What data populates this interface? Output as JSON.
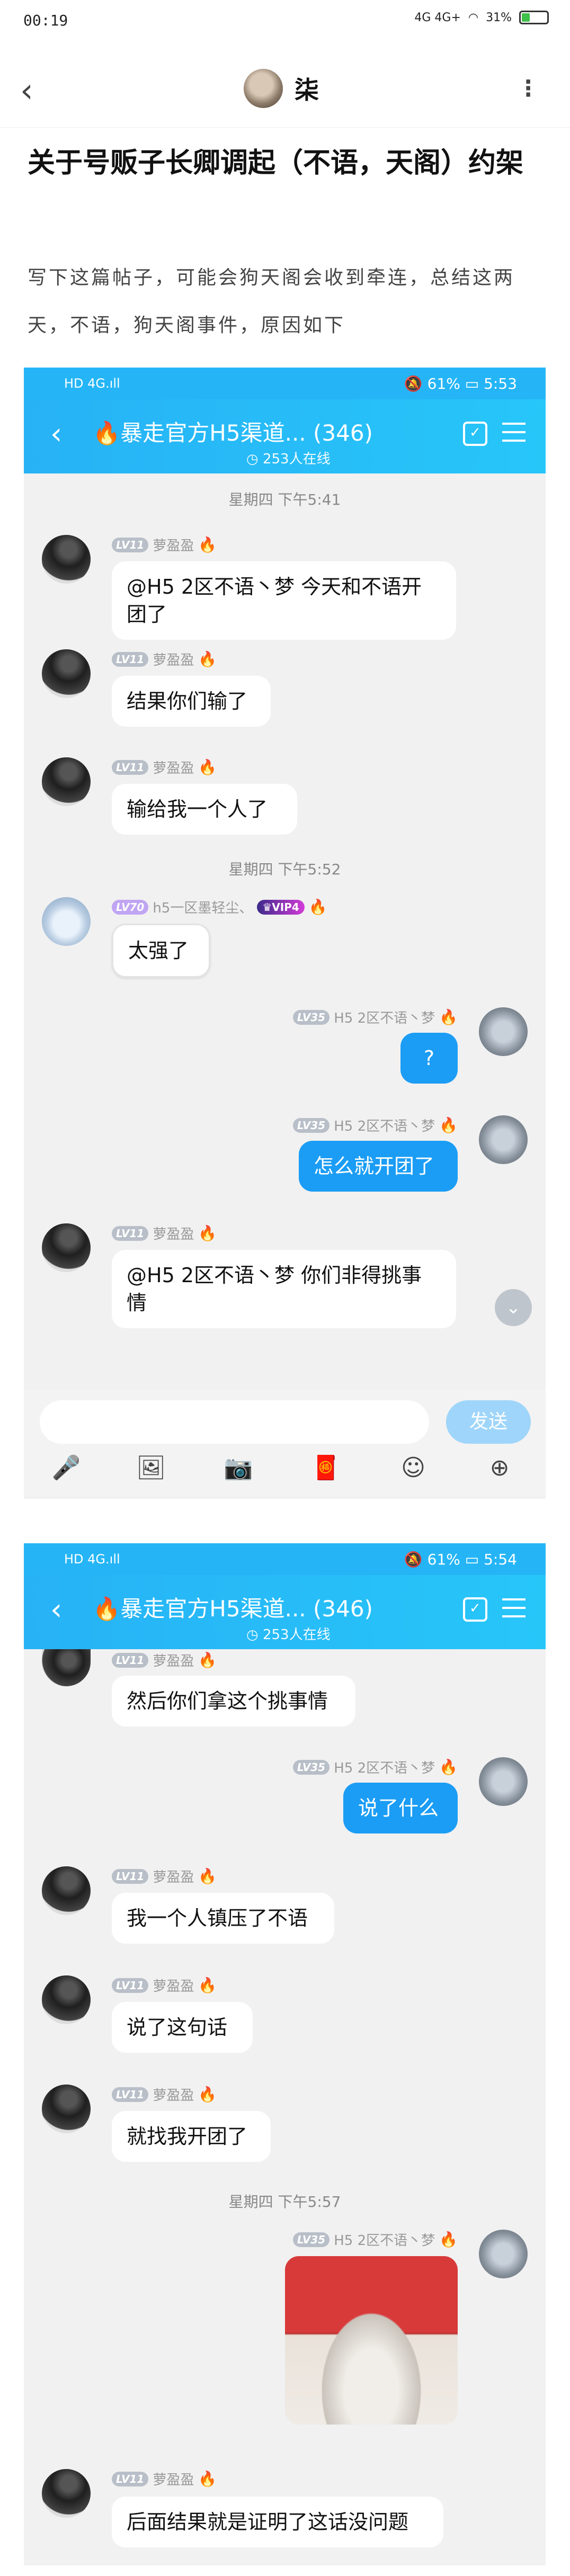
{
  "status_bar": {
    "time": "00:19",
    "signal": "4G  4G+",
    "battery": "31%"
  },
  "post": {
    "author": "柒",
    "title": "关于号贩子长卿调起（不语，天阁）约架",
    "body": "写下这篇帖子，可能会狗天阁会收到牵连，总结这两天，不语，狗天阁事件，原因如下"
  },
  "shots": [
    {
      "status": {
        "left": "HD 4G.ıll",
        "right": "🔕 61% ▭ 5:53"
      },
      "title": "🔥暴走官方H5渠道... (346)",
      "online": "◷ 253人在线",
      "messages": [
        {
          "type": "time",
          "text": "星期四 下午5:41"
        },
        {
          "type": "other",
          "lv": "LV11",
          "name": "萝盈盈",
          "text": "@H5 2区不语丶梦 今天和不语开团了"
        },
        {
          "type": "other",
          "lv": "LV11",
          "name": "萝盈盈",
          "text": "结果你们输了"
        },
        {
          "type": "other",
          "lv": "LV11",
          "name": "萝盈盈",
          "text": "输给我一个人了"
        },
        {
          "type": "time",
          "text": "星期四 下午5:52"
        },
        {
          "type": "other2",
          "lv": "LV70",
          "name": "h5一区墨轻尘、",
          "vip": "♛VIP4",
          "text": "太强了"
        },
        {
          "type": "me",
          "lv": "LV35",
          "name": "H5 2区不语丶梦",
          "text": "?"
        },
        {
          "type": "me",
          "lv": "LV35",
          "name": "H5 2区不语丶梦",
          "text": "怎么就开团了"
        },
        {
          "type": "other",
          "lv": "LV11",
          "name": "萝盈盈",
          "text": "@H5 2区不语丶梦 你们非得挑事情"
        }
      ],
      "send_label": "发送"
    },
    {
      "status": {
        "left": "HD 4G.ıll",
        "right": "🔕 61% ▭ 5:54"
      },
      "title": "🔥暴走官方H5渠道... (346)",
      "online": "◷ 253人在线",
      "messages": [
        {
          "type": "other",
          "lv": "LV11",
          "name": "萝盈盈",
          "text": "然后你们拿这个挑事情"
        },
        {
          "type": "me",
          "lv": "LV35",
          "name": "H5 2区不语丶梦",
          "text": "说了什么"
        },
        {
          "type": "other",
          "lv": "LV11",
          "name": "萝盈盈",
          "text": "我一个人镇压了不语"
        },
        {
          "type": "other",
          "lv": "LV11",
          "name": "萝盈盈",
          "text": "说了这句话"
        },
        {
          "type": "other",
          "lv": "LV11",
          "name": "萝盈盈",
          "text": "就找我开团了"
        },
        {
          "type": "time",
          "text": "星期四 下午5:57"
        },
        {
          "type": "me",
          "lv": "LV35",
          "name": "H5 2区不语丶梦",
          "text": ""
        },
        {
          "type": "other",
          "lv": "LV11",
          "name": "萝盈盈",
          "text": "后面结果就是证明了这话没问题"
        }
      ]
    }
  ]
}
